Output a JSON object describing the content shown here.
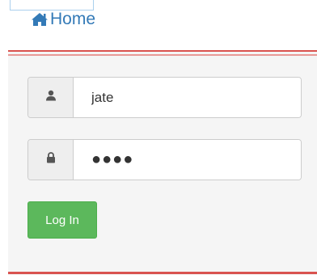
{
  "nav": {
    "home_label": "Home",
    "home_icon": "home-icon"
  },
  "login_form": {
    "username": {
      "icon": "user-icon",
      "value": "jate"
    },
    "password": {
      "icon": "lock-icon",
      "value": "●●●●"
    },
    "submit_label": "Log In"
  },
  "colors": {
    "accent_red": "#d9534f",
    "link_blue": "#337ab7",
    "button_green": "#5cb85c"
  }
}
